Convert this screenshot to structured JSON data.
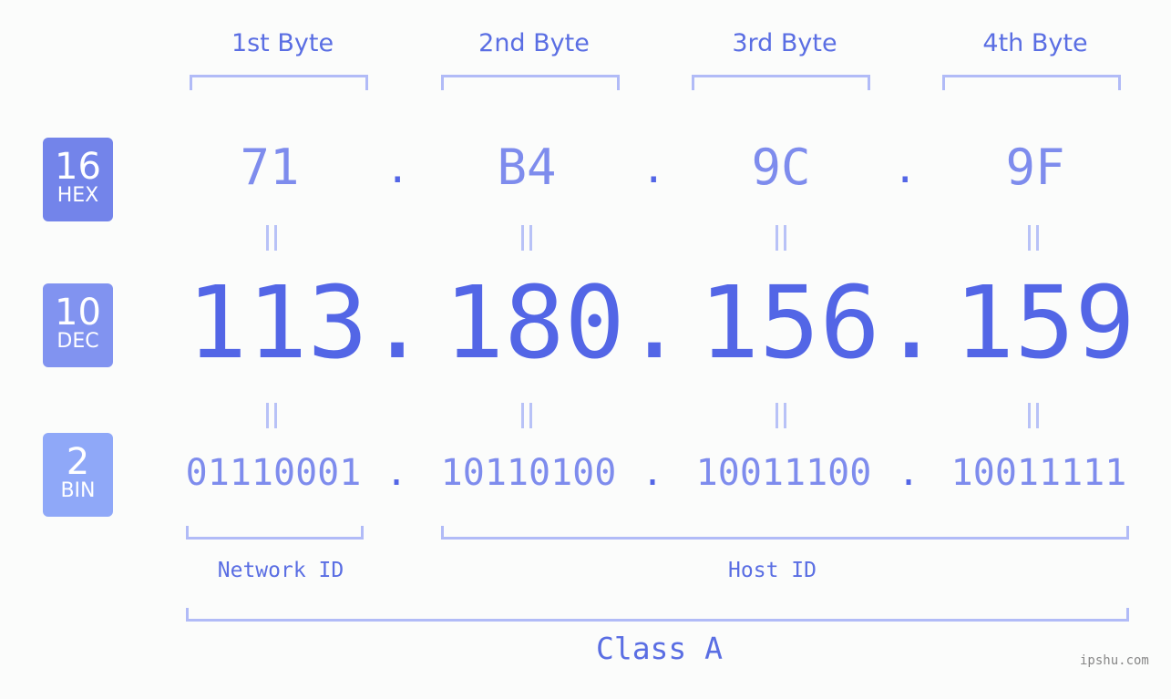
{
  "byte_headers": [
    "1st Byte",
    "2nd Byte",
    "3rd Byte",
    "4th Byte"
  ],
  "badges": [
    {
      "number": "16",
      "label": "HEX",
      "color": "#7384ea"
    },
    {
      "number": "10",
      "label": "DEC",
      "color": "#8193f0"
    },
    {
      "number": "2",
      "label": "BIN",
      "color": "#8fa8f8"
    }
  ],
  "hex": [
    "71",
    "B4",
    "9C",
    "9F"
  ],
  "dec": [
    "113",
    "180",
    "156",
    "159"
  ],
  "bin": [
    "01110001",
    "10110100",
    "10011100",
    "10011111"
  ],
  "separator": ".",
  "network_label": "Network ID",
  "host_label": "Host ID",
  "class_label": "Class A",
  "footer": "ipshu.com",
  "colors": {
    "accent": "#5366e6",
    "light": "#7e8ced",
    "bracket": "#b1bbf7"
  }
}
